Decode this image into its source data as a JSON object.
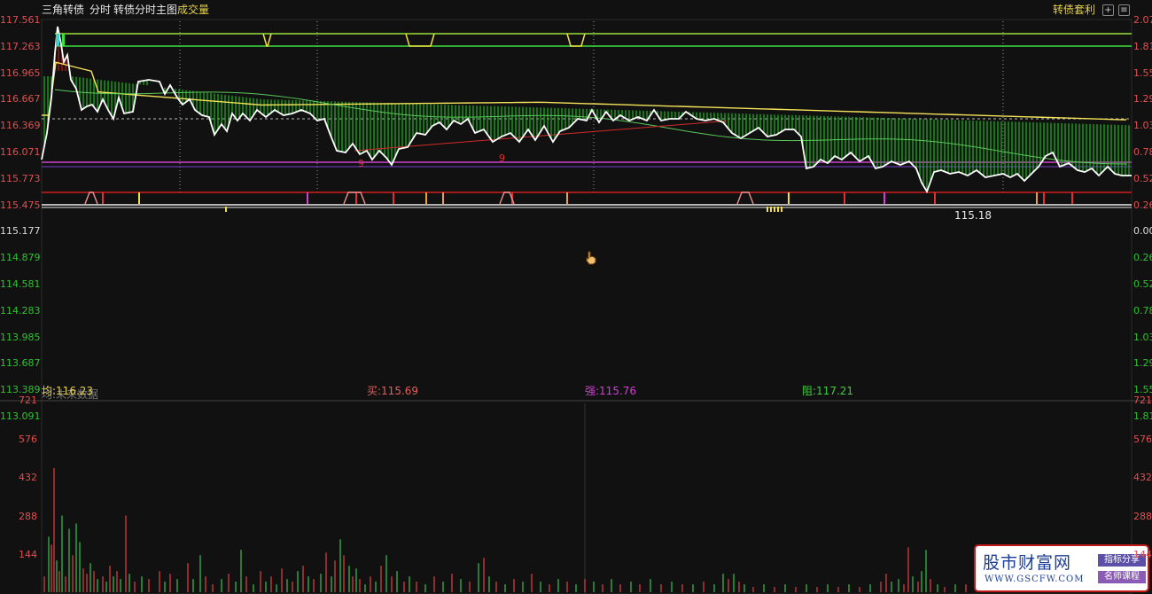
{
  "header": {
    "title": "三角转债",
    "mode": "分时",
    "chart_title": "转债分时主图",
    "volume_label": "成交量",
    "right_label": "转债套利",
    "add_icon": "+",
    "menu_icon": "≡"
  },
  "left_axis": [
    "117.561",
    "117.263",
    "116.965",
    "116.667",
    "116.369",
    "116.071",
    "115.773",
    "115.475",
    "115.177",
    "114.879",
    "114.581",
    "114.283",
    "113.985",
    "113.687",
    "113.389",
    "113.091"
  ],
  "right_axis": [
    "2.07",
    "1.81",
    "1.55",
    "1.29",
    "1.03",
    "0.78",
    "0.52",
    "0.26",
    "0.00",
    "0.26",
    "0.52",
    "0.78",
    "1.03",
    "1.29",
    "1.55",
    "1.81"
  ],
  "vol_left_axis": [
    "721",
    "576",
    "432",
    "288",
    "144"
  ],
  "vol_right_axis": [
    "721",
    "576",
    "432",
    "288",
    "144"
  ],
  "readouts": {
    "avg": "均:116.23",
    "buy": "买:115.69",
    "strong": "强:115.76",
    "resist": "阻:117.21",
    "ghost": "均:未来数据",
    "last_price": "115.18"
  },
  "signals": {
    "marker_a": "9",
    "marker_b": "9"
  },
  "watermark": {
    "main": "股市财富网",
    "url": "WWW.GSCFW.COM",
    "tag1": "指标分享",
    "tag2": "名师课程"
  },
  "colors": {
    "bg": "#111111",
    "grid": "#5a1010",
    "price": "#ffffff",
    "avg": "#f5e35a",
    "up": "#e03232",
    "down": "#1fc41f",
    "magenta": "#d23fd2",
    "neg_axis": "#26c926"
  }
}
